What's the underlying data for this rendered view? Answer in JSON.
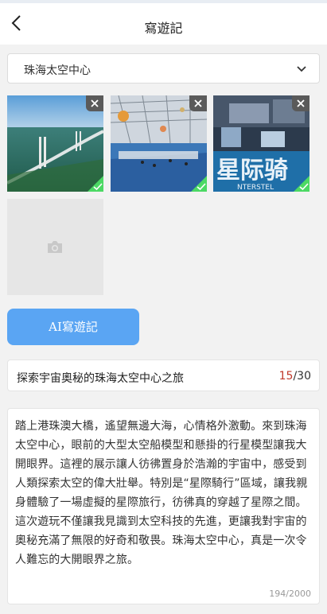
{
  "header": {
    "title": "寫遊記",
    "back_icon": "chevron-left-icon"
  },
  "location_select": {
    "value": "珠海太空中心",
    "icon": "chevron-down-icon"
  },
  "photos": [
    {
      "name": "bridge-photo"
    },
    {
      "name": "hall-photo"
    },
    {
      "name": "sign-photo"
    }
  ],
  "add_photo": {
    "icon": "camera-icon"
  },
  "ai_button": {
    "label": "AI寫遊記"
  },
  "title_field": {
    "value": "探索宇宙奧秘的珠海太空中心之旅",
    "count": "15",
    "max": "/30"
  },
  "content_field": {
    "value": "踏上港珠澳大橋，遙望無邊大海，心情格外激動。來到珠海太空中心，眼前的大型太空船模型和懸掛的行星模型讓我大開眼界。這裡的展示讓人彷彿置身於浩瀚的宇宙中，感受到人類探索太空的偉大壯舉。特別是“星際騎行”區域，讓我親身體驗了一場虛擬的星際旅行，彷彿真的穿越了星際之間。這次遊玩不僅讓我見識到太空科技的先進，更讓我對宇宙的奧秘充滿了無限的好奇和敬畏。珠海太空中心，真是一次令人難忘的大開眼界之旅。",
    "count": "194/2000"
  },
  "colors": {
    "accent": "#5aa5f3",
    "check": "#4cd964",
    "count_red": "#c0392b"
  }
}
